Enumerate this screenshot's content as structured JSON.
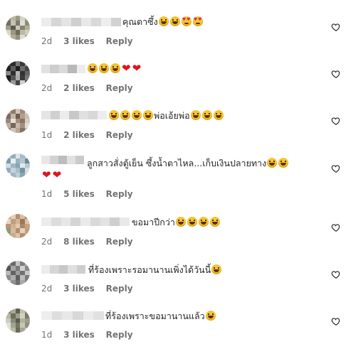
{
  "comments": [
    {
      "text": "คุณตาซึ้ง",
      "emojis_after": [
        "laugh",
        "laugh",
        "love",
        "love"
      ],
      "age": "2d",
      "likes": "3 likes",
      "reply": "Reply"
    },
    {
      "text": "",
      "emojis_after": [
        "laugh",
        "laugh",
        "laugh",
        "heart",
        "heart"
      ],
      "age": "2d",
      "likes": "2 likes",
      "reply": "Reply"
    },
    {
      "text_prefix_emojis": [
        "laugh",
        "laugh",
        "laugh",
        "laugh"
      ],
      "text": "พ่อเอ้ยพ่อ",
      "emojis_after": [
        "laugh",
        "laugh",
        "laugh"
      ],
      "age": "1d",
      "likes": "2 likes",
      "reply": "Reply"
    },
    {
      "text": "ลูกสาวสั่งตู้เย็น ซึ้งน้ำตาไหล...เก็บเงินปลายทาง",
      "emojis_after": [
        "laugh",
        "laugh"
      ],
      "second_line": [
        "heart",
        "heart"
      ],
      "age": "1d",
      "likes": "5 likes",
      "reply": "Reply"
    },
    {
      "text": "ขอมาปีกว่า",
      "emojis_after": [
        "laugh",
        "laugh",
        "laugh",
        "laugh"
      ],
      "age": "2d",
      "likes": "8 likes",
      "reply": "Reply"
    },
    {
      "text": "ที่ร้องเพราะรอมานานเพิ่งได้วันนี้",
      "emojis_after": [
        "laugh"
      ],
      "age": "2d",
      "likes": "3 likes",
      "reply": "Reply"
    },
    {
      "text": "ที่ร้องเพราะขอมานานแล้ว",
      "emojis_after": [
        "laugh"
      ],
      "age": "1d",
      "likes": "3 likes",
      "reply": "Reply"
    }
  ],
  "icons": {
    "like": "heart-outline-icon"
  }
}
